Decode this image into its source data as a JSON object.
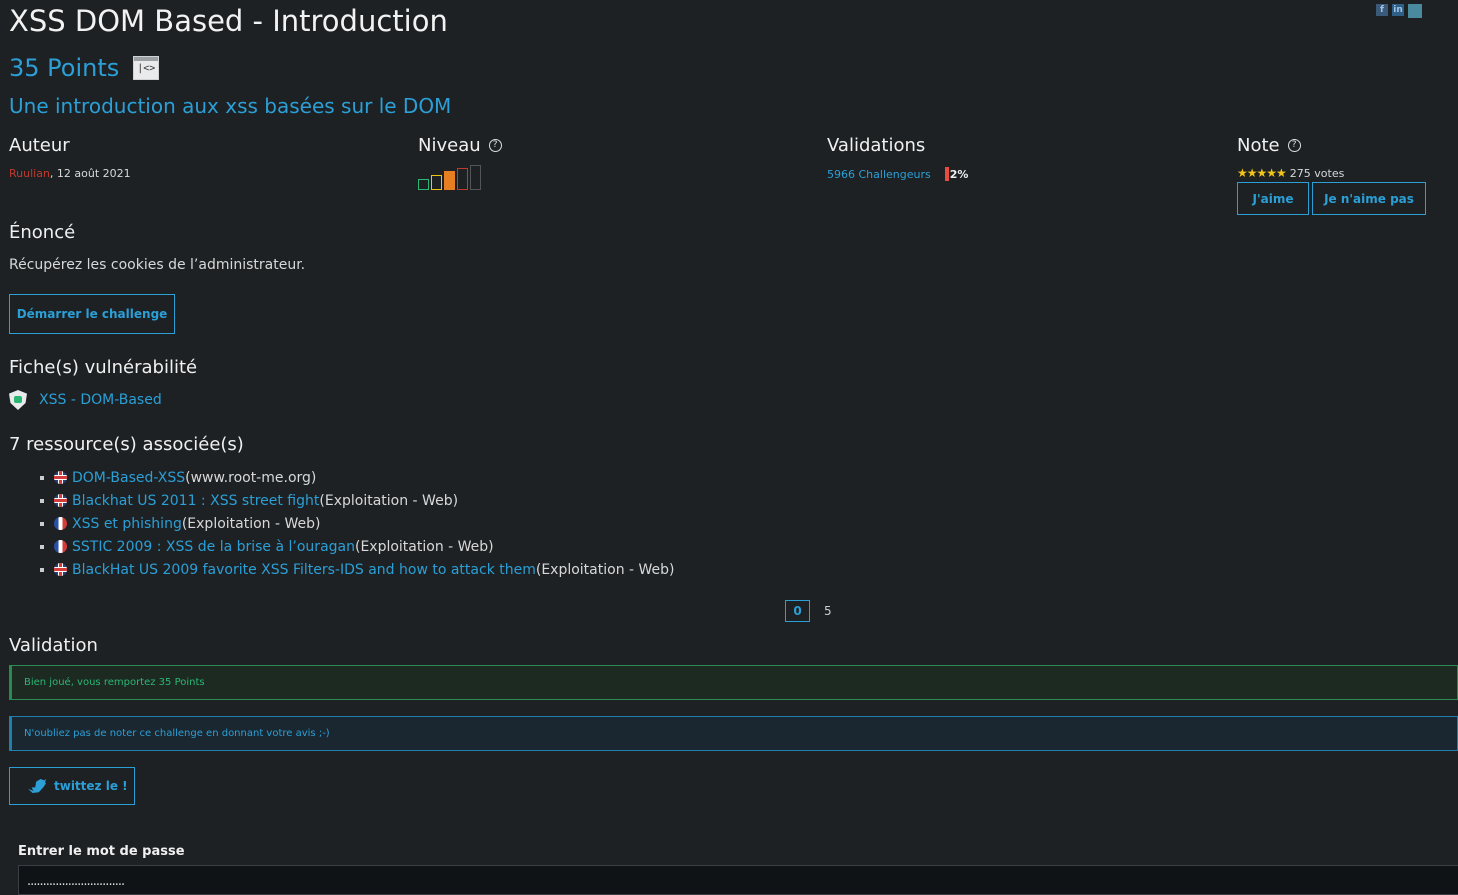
{
  "header": {
    "title": "XSS DOM Based - Introduction",
    "points": "35 Points",
    "subtitle": "Une introduction aux xss basées sur le DOM",
    "social_icons": [
      "facebook-icon",
      "linkedin-icon",
      "share-icon"
    ]
  },
  "info": {
    "author_heading": "Auteur",
    "author_name": "Ruulian",
    "author_date": ", 12 août 2021",
    "level_heading": "Niveau",
    "level_icon": "help-circle-icon",
    "level_bars": [
      {
        "color": "#2bb673",
        "filled": false
      },
      {
        "color": "#f1c40f",
        "filled": false
      },
      {
        "color": "#e67e22",
        "filled": true
      },
      {
        "color": "#c0392b",
        "filled": false
      },
      {
        "color": "#555555",
        "filled": false
      }
    ],
    "validations_heading": "Validations",
    "validations_count": "5966 Challengeurs",
    "validations_pct": "2%",
    "note_heading": "Note",
    "stars": "★★★★★",
    "votes": "275 votes",
    "like_label": "J'aime",
    "dislike_label": "Je n'aime pas"
  },
  "statement": {
    "heading": "Énoncé",
    "text": "Récupérez les cookies de l’administrateur.",
    "start_label": "Démarrer le challenge"
  },
  "vuln": {
    "heading": "Fiche(s) vulnérabilité",
    "item": "XSS - DOM-Based"
  },
  "resources": {
    "heading": "7 ressource(s) associée(s)",
    "items": [
      {
        "flag": "uk",
        "link": "DOM-Based-XSS",
        "suffix": " (www.root-me.org)"
      },
      {
        "flag": "uk",
        "link": "Blackhat US 2011 : XSS street fight",
        "suffix": " (Exploitation - Web)"
      },
      {
        "flag": "fr",
        "link": "XSS et phishing",
        "suffix": " (Exploitation - Web)"
      },
      {
        "flag": "fr",
        "link": "SSTIC 2009 : XSS de la brise à l’ouragan",
        "suffix": " (Exploitation - Web)"
      },
      {
        "flag": "uk",
        "link": "BlackHat US 2009 favorite XSS Filters-IDS and how to attack them",
        "suffix": " (Exploitation - Web)"
      }
    ],
    "pager": {
      "current": "0",
      "next": "5"
    }
  },
  "validation": {
    "heading": "Validation",
    "success": "Bien joué, vous remportez 35 Points",
    "info": "N'oubliez pas de noter ce challenge en donnant votre avis ;-)",
    "tweet_label": "twittez le !"
  },
  "password": {
    "label": "Entrer le mot de passe",
    "value": "..............................."
  }
}
